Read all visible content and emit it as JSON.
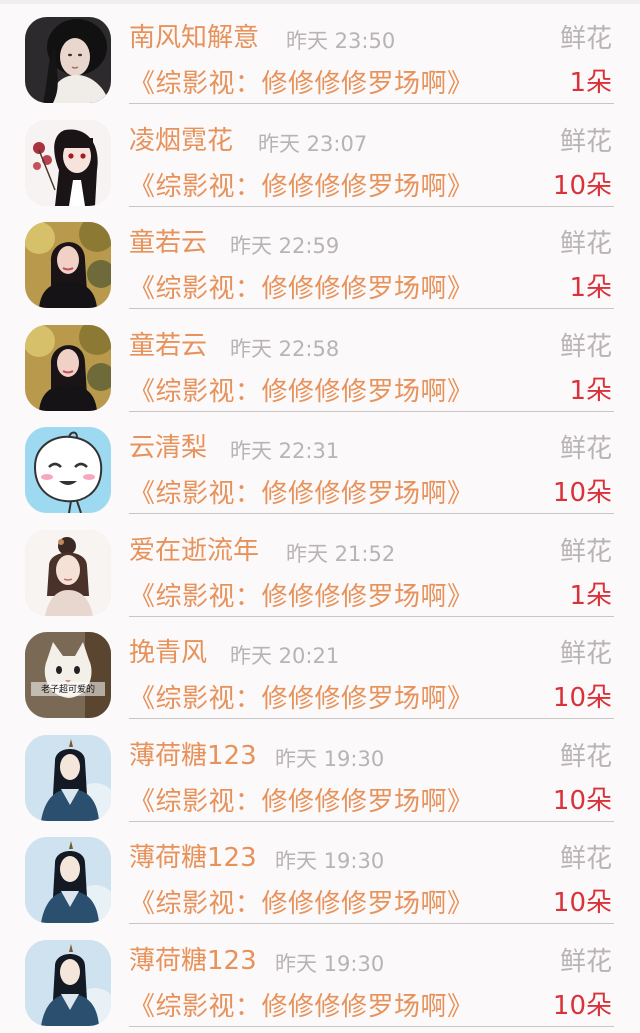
{
  "colors": {
    "name": "#e7925a",
    "book": "#e7925a",
    "muted": "#b8b3b4",
    "count": "#d9323a",
    "divider": "#c8c6c7"
  },
  "items": [
    {
      "name": "南风知解意",
      "time": "昨天 23:50",
      "label": "鲜花",
      "book": "《综影视：修修修修罗场啊》",
      "count": "1朵",
      "avatar": "avatar-girl-dark-hair-icon"
    },
    {
      "name": "凌烟霓花",
      "time": "昨天 23:07",
      "label": "鲜花",
      "book": "《综影视：修修修修罗场啊》",
      "count": "10朵",
      "avatar": "avatar-anime-girl-flowers-icon"
    },
    {
      "name": "童若云",
      "time": "昨天 22:59",
      "label": "鲜花",
      "book": "《综影视：修修修修罗场啊》",
      "count": "1朵",
      "avatar": "avatar-woman-photo-icon"
    },
    {
      "name": "童若云",
      "time": "昨天 22:58",
      "label": "鲜花",
      "book": "《综影视：修修修修罗场啊》",
      "count": "1朵",
      "avatar": "avatar-woman-photo-icon"
    },
    {
      "name": "云清梨",
      "time": "昨天 22:31",
      "label": "鲜花",
      "book": "《综影视：修修修修罗场啊》",
      "count": "10朵",
      "avatar": "avatar-cartoon-blush-face-icon"
    },
    {
      "name": "爱在逝流年",
      "time": "昨天 21:52",
      "label": "鲜花",
      "book": "《综影视：修修修修罗场啊》",
      "count": "1朵",
      "avatar": "avatar-ink-painting-girl-icon"
    },
    {
      "name": "挽青风",
      "time": "昨天 20:21",
      "label": "鲜花",
      "book": "《综影视：修修修修罗场啊》",
      "count": "10朵",
      "avatar": "avatar-cat-meme-icon"
    },
    {
      "name": "薄荷糖123",
      "time": "昨天 19:30",
      "label": "鲜花",
      "book": "《综影视：修修修修罗场啊》",
      "count": "10朵",
      "avatar": "avatar-ancient-costume-man-icon"
    },
    {
      "name": "薄荷糖123",
      "time": "昨天 19:30",
      "label": "鲜花",
      "book": "《综影视：修修修修罗场啊》",
      "count": "10朵",
      "avatar": "avatar-ancient-costume-man-icon"
    },
    {
      "name": "薄荷糖123",
      "time": "昨天 19:30",
      "label": "鲜花",
      "book": "《综影视：修修修修罗场啊》",
      "count": "10朵",
      "avatar": "avatar-ancient-costume-man-icon"
    }
  ],
  "avatar_texts": {
    "cat_meme": "老子超可爱的"
  }
}
